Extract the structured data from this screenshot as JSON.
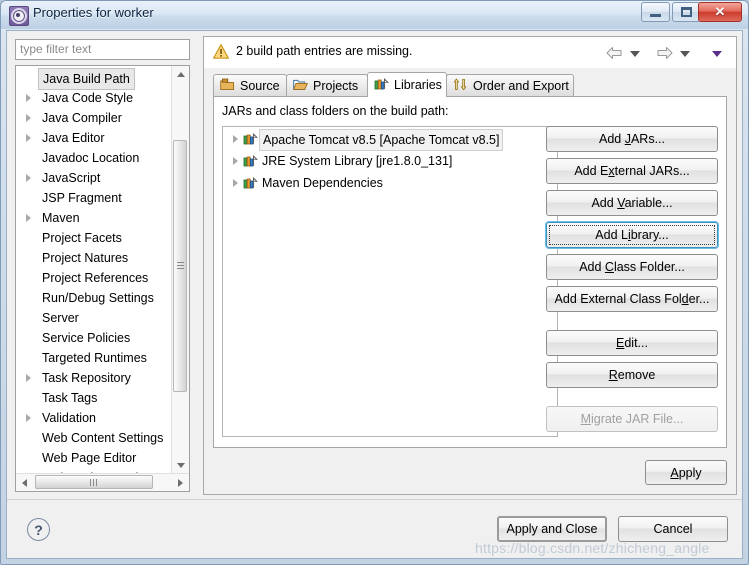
{
  "window": {
    "title": "Properties for worker",
    "icon": "eclipse-properties-gear-icon",
    "minimize_label": "",
    "maximize_label": "",
    "close_label": "✕"
  },
  "sidebar": {
    "filter_placeholder": "type filter text",
    "filter_value": "",
    "items": [
      {
        "label": "Java Build Path",
        "expandable": false,
        "selected": true
      },
      {
        "label": "Java Code Style",
        "expandable": true,
        "selected": false
      },
      {
        "label": "Java Compiler",
        "expandable": true,
        "selected": false
      },
      {
        "label": "Java Editor",
        "expandable": true,
        "selected": false
      },
      {
        "label": "Javadoc Location",
        "expandable": false,
        "selected": false
      },
      {
        "label": "JavaScript",
        "expandable": true,
        "selected": false
      },
      {
        "label": "JSP Fragment",
        "expandable": false,
        "selected": false
      },
      {
        "label": "Maven",
        "expandable": true,
        "selected": false
      },
      {
        "label": "Project Facets",
        "expandable": false,
        "selected": false
      },
      {
        "label": "Project Natures",
        "expandable": false,
        "selected": false
      },
      {
        "label": "Project References",
        "expandable": false,
        "selected": false
      },
      {
        "label": "Run/Debug Settings",
        "expandable": false,
        "selected": false
      },
      {
        "label": "Server",
        "expandable": false,
        "selected": false
      },
      {
        "label": "Service Policies",
        "expandable": false,
        "selected": false
      },
      {
        "label": "Targeted Runtimes",
        "expandable": false,
        "selected": false
      },
      {
        "label": "Task Repository",
        "expandable": true,
        "selected": false
      },
      {
        "label": "Task Tags",
        "expandable": false,
        "selected": false
      },
      {
        "label": "Validation",
        "expandable": true,
        "selected": false
      },
      {
        "label": "Web Content Settings",
        "expandable": false,
        "selected": false
      },
      {
        "label": "Web Page Editor",
        "expandable": false,
        "selected": false
      },
      {
        "label": "Web Project Settings",
        "expandable": false,
        "selected": false
      }
    ]
  },
  "header": {
    "warning_text": "2 build path entries are missing.",
    "warning_icon": "warning-triangle-icon",
    "back_icon": "back-arrow-icon",
    "forward_icon": "forward-arrow-icon",
    "menu_icon": "view-menu-caret-icon"
  },
  "main": {
    "tabs": [
      {
        "label": "Source",
        "icon": "source-folder-icon",
        "active": false
      },
      {
        "label": "Projects",
        "icon": "open-folder-icon",
        "active": false
      },
      {
        "label": "Libraries",
        "icon": "books-icon",
        "active": true
      },
      {
        "label": "Order and Export",
        "icon": "order-arrows-icon",
        "active": false
      }
    ],
    "panel_label": "JARs and class folders on the build path:",
    "libraries": [
      {
        "label": "Apache Tomcat v8.5 [Apache Tomcat v8.5]",
        "selected": true
      },
      {
        "label": "JRE System Library [jre1.8.0_131]",
        "selected": false
      },
      {
        "label": "Maven Dependencies",
        "selected": false
      }
    ],
    "side_buttons": [
      {
        "pre": "Add ",
        "mnemonic": "J",
        "post": "ARs...",
        "state": "normal"
      },
      {
        "pre": "Add E",
        "mnemonic": "x",
        "post": "ternal JARs...",
        "state": "normal"
      },
      {
        "pre": "Add ",
        "mnemonic": "V",
        "post": "ariable...",
        "state": "normal"
      },
      {
        "pre": "Add L",
        "mnemonic": "i",
        "post": "brary...",
        "state": "focused"
      },
      {
        "pre": "Add ",
        "mnemonic": "C",
        "post": "lass Folder...",
        "state": "normal"
      },
      {
        "pre": "Add External Class Fol",
        "mnemonic": "d",
        "post": "er...",
        "state": "normal"
      },
      {
        "pre": "",
        "mnemonic": "E",
        "post": "dit...",
        "state": "normal"
      },
      {
        "pre": "",
        "mnemonic": "R",
        "post": "emove",
        "state": "normal"
      },
      {
        "pre": "",
        "mnemonic": "M",
        "post": "igrate JAR File...",
        "state": "disabled"
      }
    ],
    "apply": {
      "pre": "",
      "mnemonic": "A",
      "post": "pply"
    }
  },
  "footer": {
    "help_label": "?",
    "apply_and_close_label": "Apply and Close",
    "cancel_label": "Cancel"
  },
  "watermark": "https://blog.csdn.net/zhicheng_angle"
}
